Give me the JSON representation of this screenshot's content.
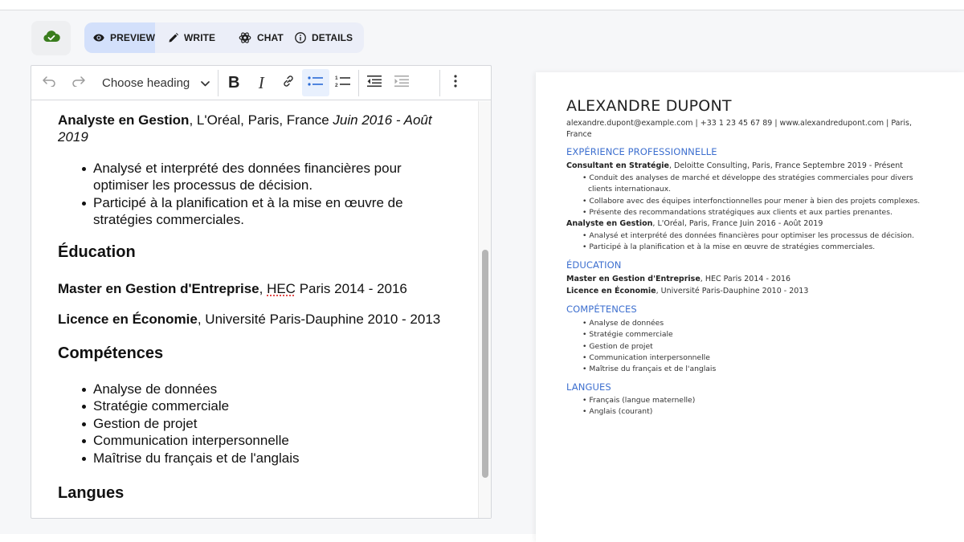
{
  "colors": {
    "accent": "#3d6fcf",
    "active_tab_bg": "#d3e0fb",
    "sync_green": "#3a7d1e"
  },
  "topbar": {
    "sync_icon": "cloud-check-icon",
    "tabs": [
      {
        "label": "PREVIEW",
        "icon": "eye-icon",
        "active": true
      },
      {
        "label": "WRITE",
        "icon": "pencil-icon",
        "active": false
      },
      {
        "label": "CHAT",
        "icon": "openai-icon",
        "active": false
      },
      {
        "label": "DETAILS",
        "icon": "info-icon",
        "active": false
      }
    ]
  },
  "editor_toolbar": {
    "undo_icon": "undo-icon",
    "redo_icon": "redo-icon",
    "heading_select": "Choose heading",
    "bold_label": "B",
    "italic_label": "I",
    "link_icon": "link-icon",
    "bulleted_list_active": true,
    "numbered_list_icon": "numbered-list-icon",
    "outdent_icon": "outdent-icon",
    "indent_icon": "indent-icon",
    "more_icon": "more-vertical-icon"
  },
  "editor": {
    "job2": {
      "title": "Analyste en Gestion",
      "company": ", L'Oréal, Paris, France ",
      "dates": "Juin 2016 - Août 2019",
      "bullets": [
        "Analysé et interprété des données financières pour optimiser les processus de décision.",
        "Participé à la planification et à la mise en œuvre de stratégies commerciales."
      ]
    },
    "education_heading": "Éducation",
    "education": [
      {
        "degree": "Master en Gestion d'Entreprise",
        "sep": ", ",
        "school_flagged": "HEC",
        "rest": " Paris 2014 - 2016"
      },
      {
        "degree": "Licence en Économie",
        "sep": ", ",
        "rest": "Université Paris-Dauphine 2010 - 2013"
      }
    ],
    "skills_heading": "Compétences",
    "skills": [
      "Analyse de données",
      "Stratégie commerciale",
      "Gestion de projet",
      "Communication interpersonnelle",
      "Maîtrise du français et de l'anglais"
    ],
    "languages_heading": "Langues",
    "scroll_position_fraction": 0.55
  },
  "preview": {
    "name": "ALEXANDRE DUPONT",
    "contact": "alexandre.dupont@example.com | +33 1 23 45 67 89 | www.alexandredupont.com | Paris, France",
    "experience_heading": "EXPÉRIENCE PROFESSIONNELLE",
    "jobs": [
      {
        "title": "Consultant en Stratégie",
        "details": ", Deloitte Consulting, Paris, France Septembre 2019 - Présent",
        "bullets": [
          "Conduit des analyses de marché et développe des stratégies commerciales pour divers clients internationaux.",
          "Collabore avec des équipes interfonctionnelles pour mener à bien des projets complexes.",
          "Présente des recommandations stratégiques aux clients et aux parties prenantes."
        ]
      },
      {
        "title": "Analyste en Gestion",
        "details": ", L'Oréal, Paris, France Juin 2016 - Août 2019",
        "bullets": [
          "Analysé et interprété des données financières pour optimiser les processus de décision.",
          "Participé à la planification et à la mise en œuvre de stratégies commerciales."
        ]
      }
    ],
    "education_heading": "ÉDUCATION",
    "education": [
      {
        "degree": "Master en Gestion d'Entreprise",
        "details": ", HEC Paris 2014 - 2016"
      },
      {
        "degree": "Licence en Économie",
        "details": ", Université Paris-Dauphine 2010 - 2013"
      }
    ],
    "skills_heading": "COMPÉTENCES",
    "skills": [
      "Analyse de données",
      "Stratégie commerciale",
      "Gestion de projet",
      "Communication interpersonnelle",
      "Maîtrise du français et de l'anglais"
    ],
    "languages_heading": "LANGUES",
    "languages": [
      "Français (langue maternelle)",
      "Anglais (courant)"
    ]
  }
}
